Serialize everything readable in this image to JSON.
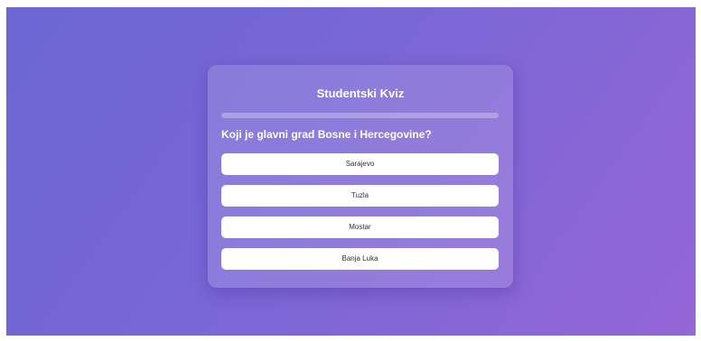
{
  "quiz": {
    "title": "Studentski Kviz",
    "progress_percent": 0,
    "question": "Koji je glavni grad Bosne i Hercegovine?",
    "answers": [
      {
        "label": "Sarajevo"
      },
      {
        "label": "Tuzla"
      },
      {
        "label": "Mostar"
      },
      {
        "label": "Banja Luka"
      }
    ]
  },
  "colors": {
    "background_start": "#6b67d4",
    "background_end": "#9466d6",
    "button_bg": "#ffffff",
    "text_light": "#ffffff"
  }
}
